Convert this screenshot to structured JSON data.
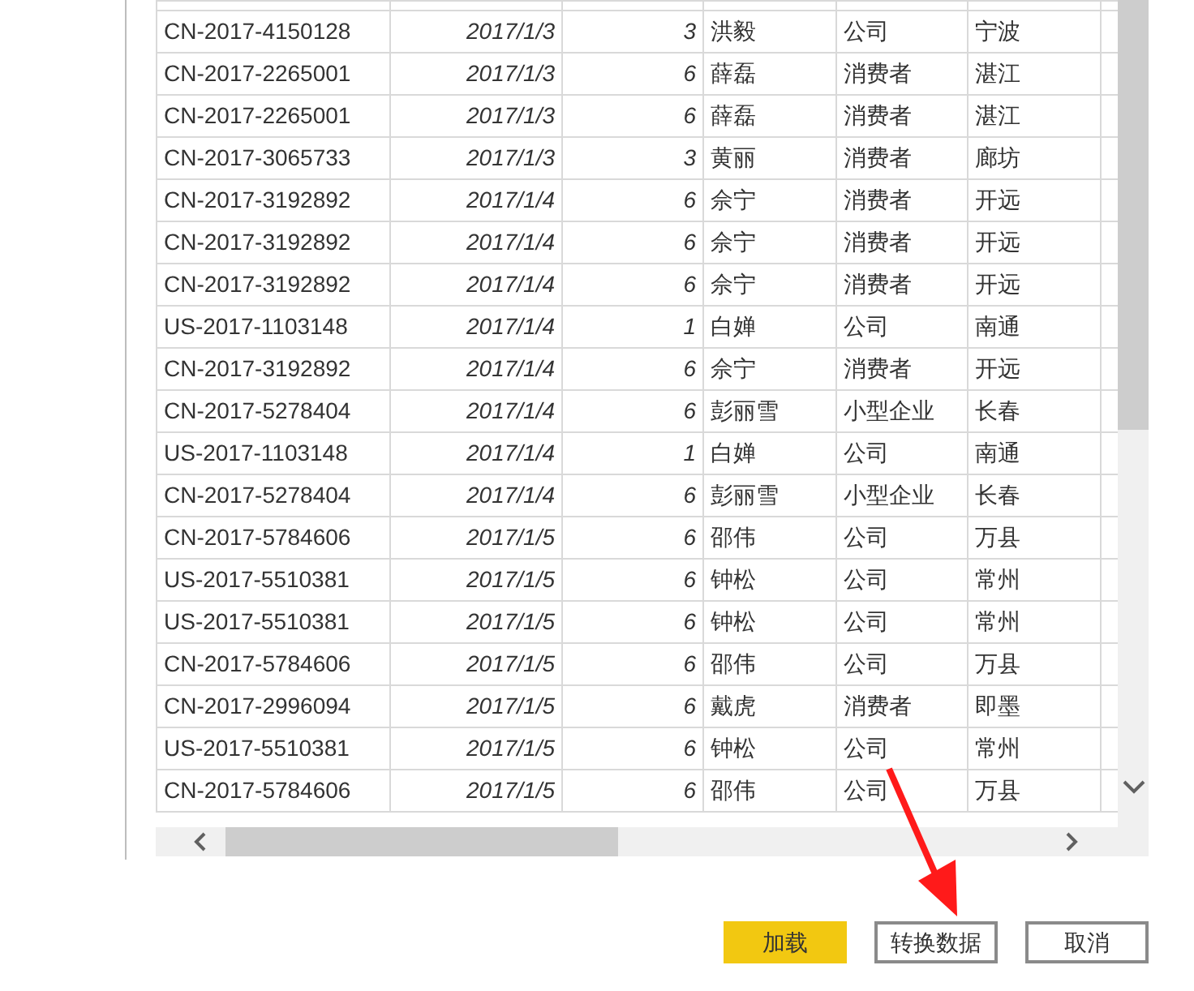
{
  "table": {
    "rows": [
      [
        "CN-2017-4150128",
        "2017/1/3",
        "3",
        "洪毅",
        "公司",
        "宁波"
      ],
      [
        "CN-2017-2265001",
        "2017/1/3",
        "6",
        "薛磊",
        "消费者",
        "湛江"
      ],
      [
        "CN-2017-2265001",
        "2017/1/3",
        "6",
        "薛磊",
        "消费者",
        "湛江"
      ],
      [
        "CN-2017-3065733",
        "2017/1/3",
        "3",
        "黄丽",
        "消费者",
        "廊坊"
      ],
      [
        "CN-2017-3192892",
        "2017/1/4",
        "6",
        "佘宁",
        "消费者",
        "开远"
      ],
      [
        "CN-2017-3192892",
        "2017/1/4",
        "6",
        "佘宁",
        "消费者",
        "开远"
      ],
      [
        "CN-2017-3192892",
        "2017/1/4",
        "6",
        "佘宁",
        "消费者",
        "开远"
      ],
      [
        "US-2017-1103148",
        "2017/1/4",
        "1",
        "白婵",
        "公司",
        "南通"
      ],
      [
        "CN-2017-3192892",
        "2017/1/4",
        "6",
        "佘宁",
        "消费者",
        "开远"
      ],
      [
        "CN-2017-5278404",
        "2017/1/4",
        "6",
        "彭丽雪",
        "小型企业",
        "长春"
      ],
      [
        "US-2017-1103148",
        "2017/1/4",
        "1",
        "白婵",
        "公司",
        "南通"
      ],
      [
        "CN-2017-5278404",
        "2017/1/4",
        "6",
        "彭丽雪",
        "小型企业",
        "长春"
      ],
      [
        "CN-2017-5784606",
        "2017/1/5",
        "6",
        "邵伟",
        "公司",
        "万县"
      ],
      [
        "US-2017-5510381",
        "2017/1/5",
        "6",
        "钟松",
        "公司",
        "常州"
      ],
      [
        "US-2017-5510381",
        "2017/1/5",
        "6",
        "钟松",
        "公司",
        "常州"
      ],
      [
        "CN-2017-5784606",
        "2017/1/5",
        "6",
        "邵伟",
        "公司",
        "万县"
      ],
      [
        "CN-2017-2996094",
        "2017/1/5",
        "6",
        "戴虎",
        "消费者",
        "即墨"
      ],
      [
        "US-2017-5510381",
        "2017/1/5",
        "6",
        "钟松",
        "公司",
        "常州"
      ],
      [
        "CN-2017-5784606",
        "2017/1/5",
        "6",
        "邵伟",
        "公司",
        "万县"
      ]
    ]
  },
  "buttons": [
    {
      "label": "加载",
      "kind": "primary"
    },
    {
      "label": "转换数据",
      "kind": "default"
    },
    {
      "label": "取消",
      "kind": "default"
    }
  ]
}
